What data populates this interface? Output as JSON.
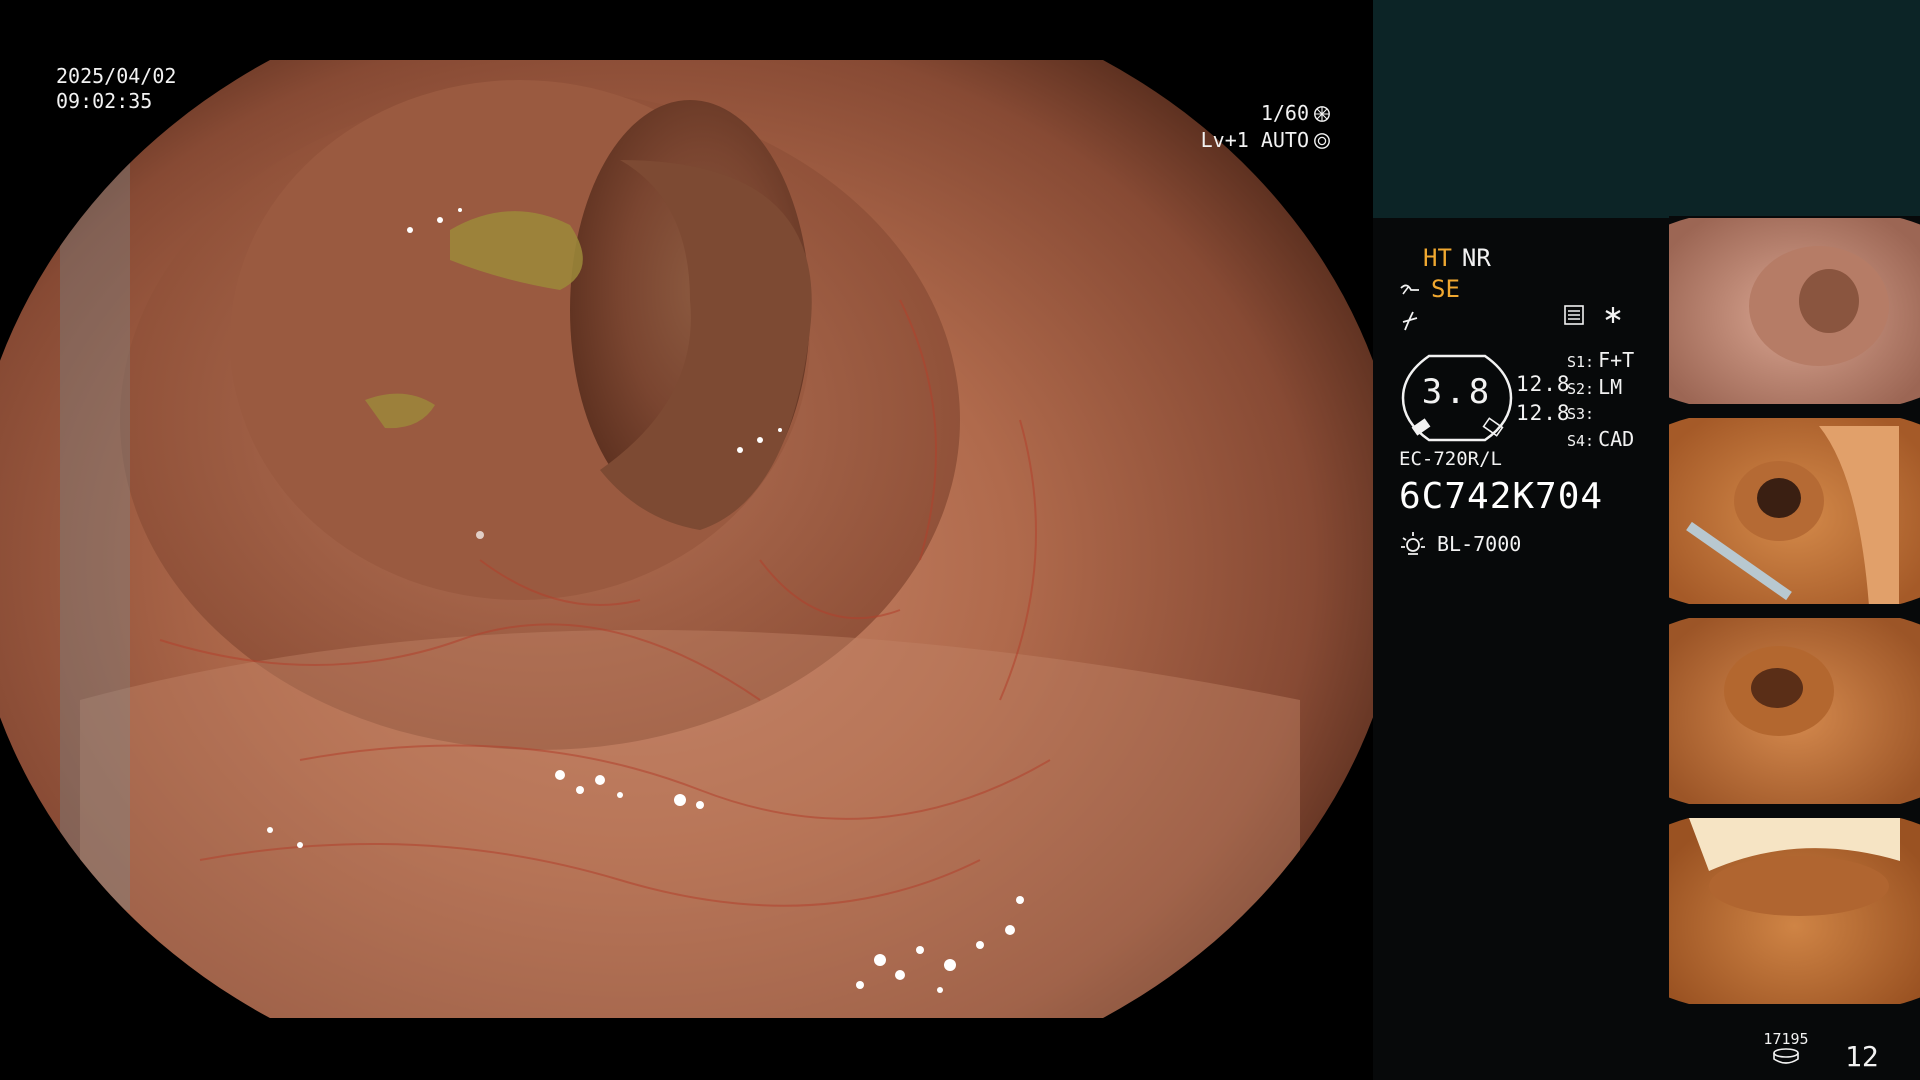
{
  "main": {
    "date": "2025/04/02",
    "time": "09:02:35",
    "shutter_speed": "1/60",
    "exposure_mode": "Lv+1 AUTO"
  },
  "panel": {
    "modes": {
      "ht": "HT",
      "nr": "NR",
      "se": "SE"
    },
    "gauge": {
      "value": "3.8",
      "sub_top": "12.8",
      "sub_bottom": "12.8"
    },
    "settings": [
      {
        "label": "S1:",
        "value": "F+T"
      },
      {
        "label": "S2:",
        "value": "LM"
      },
      {
        "label": "S3:",
        "value": ""
      },
      {
        "label": "S4:",
        "value": "CAD"
      }
    ],
    "scope_model": "EC-720R/L",
    "serial": "6C742K704",
    "light_source": "BL-7000",
    "storage_count": "17195",
    "image_count": "12"
  },
  "colors": {
    "accent_orange": "#f0a830",
    "panel_top": "#0c2426",
    "panel_bg": "#07090a"
  },
  "icons": {
    "shutter": "aperture-icon",
    "auto": "auto-iris-icon",
    "scope": "scope-icon",
    "pump": "pump-icon",
    "menu": "menu-icon",
    "asterisk": "asterisk-icon",
    "light": "lamp-icon",
    "storage": "storage-icon"
  }
}
